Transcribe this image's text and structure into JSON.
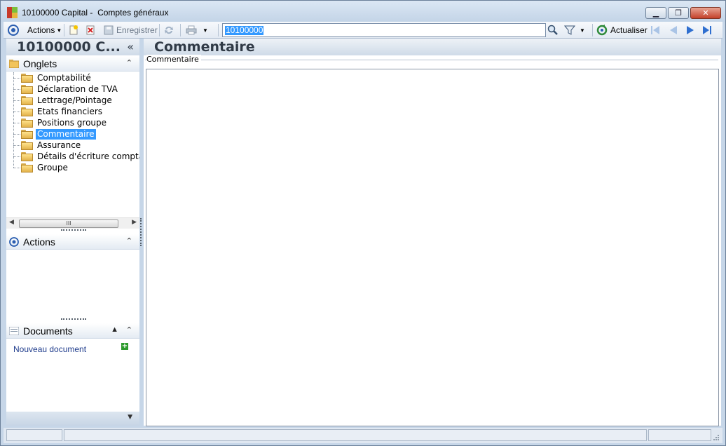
{
  "window": {
    "record_code": "10100000 Capital -",
    "form_name": "Comptes généraux",
    "minimize_glyph": "▁",
    "restore_glyph": "❐",
    "close_glyph": "✕"
  },
  "toolbar": {
    "actions_label": "Actions",
    "save_label": "Enregistrer",
    "refresh_label": "Actualiser",
    "search_value": "10100000"
  },
  "left": {
    "record_title": "10100000 C...",
    "collapse_glyph": "«",
    "tabs_section": "Onglets",
    "tabs": [
      {
        "label": "Comptabilité"
      },
      {
        "label": "Déclaration de TVA"
      },
      {
        "label": "Lettrage/Pointage"
      },
      {
        "label": "Etats financiers"
      },
      {
        "label": "Positions groupe"
      },
      {
        "label": "Commentaire"
      },
      {
        "label": "Assurance"
      },
      {
        "label": "Détails d'écriture comptab"
      },
      {
        "label": "Groupe"
      }
    ],
    "selected_tab": "Commentaire",
    "actions_section": "Actions",
    "documents_section": "Documents",
    "new_document": "Nouveau document"
  },
  "main": {
    "title": "Commentaire",
    "group_label": "Commentaire",
    "comment_value": ""
  },
  "colors": {
    "selection": "#3399ff",
    "link": "#1f3c8c",
    "title_text": "#303a46"
  }
}
